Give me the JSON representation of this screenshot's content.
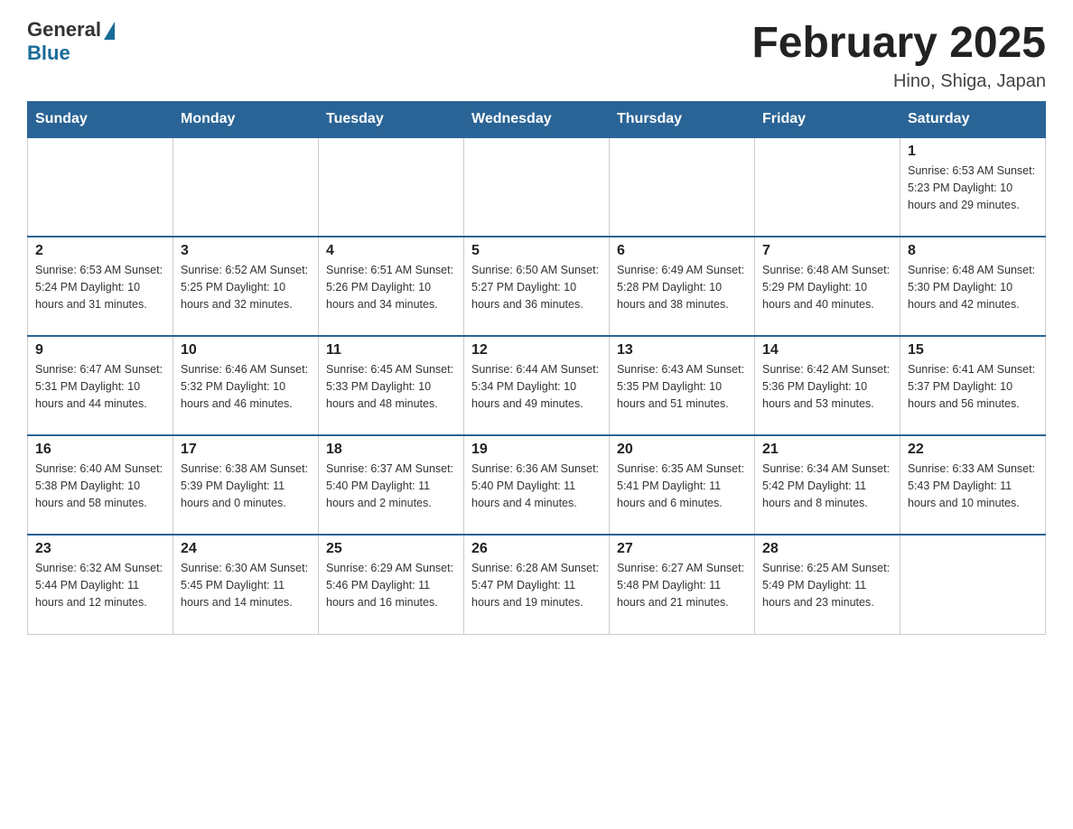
{
  "header": {
    "logo_general": "General",
    "logo_blue": "Blue",
    "title": "February 2025",
    "subtitle": "Hino, Shiga, Japan"
  },
  "weekdays": [
    "Sunday",
    "Monday",
    "Tuesday",
    "Wednesday",
    "Thursday",
    "Friday",
    "Saturday"
  ],
  "weeks": [
    [
      {
        "day": "",
        "info": ""
      },
      {
        "day": "",
        "info": ""
      },
      {
        "day": "",
        "info": ""
      },
      {
        "day": "",
        "info": ""
      },
      {
        "day": "",
        "info": ""
      },
      {
        "day": "",
        "info": ""
      },
      {
        "day": "1",
        "info": "Sunrise: 6:53 AM\nSunset: 5:23 PM\nDaylight: 10 hours\nand 29 minutes."
      }
    ],
    [
      {
        "day": "2",
        "info": "Sunrise: 6:53 AM\nSunset: 5:24 PM\nDaylight: 10 hours\nand 31 minutes."
      },
      {
        "day": "3",
        "info": "Sunrise: 6:52 AM\nSunset: 5:25 PM\nDaylight: 10 hours\nand 32 minutes."
      },
      {
        "day": "4",
        "info": "Sunrise: 6:51 AM\nSunset: 5:26 PM\nDaylight: 10 hours\nand 34 minutes."
      },
      {
        "day": "5",
        "info": "Sunrise: 6:50 AM\nSunset: 5:27 PM\nDaylight: 10 hours\nand 36 minutes."
      },
      {
        "day": "6",
        "info": "Sunrise: 6:49 AM\nSunset: 5:28 PM\nDaylight: 10 hours\nand 38 minutes."
      },
      {
        "day": "7",
        "info": "Sunrise: 6:48 AM\nSunset: 5:29 PM\nDaylight: 10 hours\nand 40 minutes."
      },
      {
        "day": "8",
        "info": "Sunrise: 6:48 AM\nSunset: 5:30 PM\nDaylight: 10 hours\nand 42 minutes."
      }
    ],
    [
      {
        "day": "9",
        "info": "Sunrise: 6:47 AM\nSunset: 5:31 PM\nDaylight: 10 hours\nand 44 minutes."
      },
      {
        "day": "10",
        "info": "Sunrise: 6:46 AM\nSunset: 5:32 PM\nDaylight: 10 hours\nand 46 minutes."
      },
      {
        "day": "11",
        "info": "Sunrise: 6:45 AM\nSunset: 5:33 PM\nDaylight: 10 hours\nand 48 minutes."
      },
      {
        "day": "12",
        "info": "Sunrise: 6:44 AM\nSunset: 5:34 PM\nDaylight: 10 hours\nand 49 minutes."
      },
      {
        "day": "13",
        "info": "Sunrise: 6:43 AM\nSunset: 5:35 PM\nDaylight: 10 hours\nand 51 minutes."
      },
      {
        "day": "14",
        "info": "Sunrise: 6:42 AM\nSunset: 5:36 PM\nDaylight: 10 hours\nand 53 minutes."
      },
      {
        "day": "15",
        "info": "Sunrise: 6:41 AM\nSunset: 5:37 PM\nDaylight: 10 hours\nand 56 minutes."
      }
    ],
    [
      {
        "day": "16",
        "info": "Sunrise: 6:40 AM\nSunset: 5:38 PM\nDaylight: 10 hours\nand 58 minutes."
      },
      {
        "day": "17",
        "info": "Sunrise: 6:38 AM\nSunset: 5:39 PM\nDaylight: 11 hours\nand 0 minutes."
      },
      {
        "day": "18",
        "info": "Sunrise: 6:37 AM\nSunset: 5:40 PM\nDaylight: 11 hours\nand 2 minutes."
      },
      {
        "day": "19",
        "info": "Sunrise: 6:36 AM\nSunset: 5:40 PM\nDaylight: 11 hours\nand 4 minutes."
      },
      {
        "day": "20",
        "info": "Sunrise: 6:35 AM\nSunset: 5:41 PM\nDaylight: 11 hours\nand 6 minutes."
      },
      {
        "day": "21",
        "info": "Sunrise: 6:34 AM\nSunset: 5:42 PM\nDaylight: 11 hours\nand 8 minutes."
      },
      {
        "day": "22",
        "info": "Sunrise: 6:33 AM\nSunset: 5:43 PM\nDaylight: 11 hours\nand 10 minutes."
      }
    ],
    [
      {
        "day": "23",
        "info": "Sunrise: 6:32 AM\nSunset: 5:44 PM\nDaylight: 11 hours\nand 12 minutes."
      },
      {
        "day": "24",
        "info": "Sunrise: 6:30 AM\nSunset: 5:45 PM\nDaylight: 11 hours\nand 14 minutes."
      },
      {
        "day": "25",
        "info": "Sunrise: 6:29 AM\nSunset: 5:46 PM\nDaylight: 11 hours\nand 16 minutes."
      },
      {
        "day": "26",
        "info": "Sunrise: 6:28 AM\nSunset: 5:47 PM\nDaylight: 11 hours\nand 19 minutes."
      },
      {
        "day": "27",
        "info": "Sunrise: 6:27 AM\nSunset: 5:48 PM\nDaylight: 11 hours\nand 21 minutes."
      },
      {
        "day": "28",
        "info": "Sunrise: 6:25 AM\nSunset: 5:49 PM\nDaylight: 11 hours\nand 23 minutes."
      },
      {
        "day": "",
        "info": ""
      }
    ]
  ]
}
